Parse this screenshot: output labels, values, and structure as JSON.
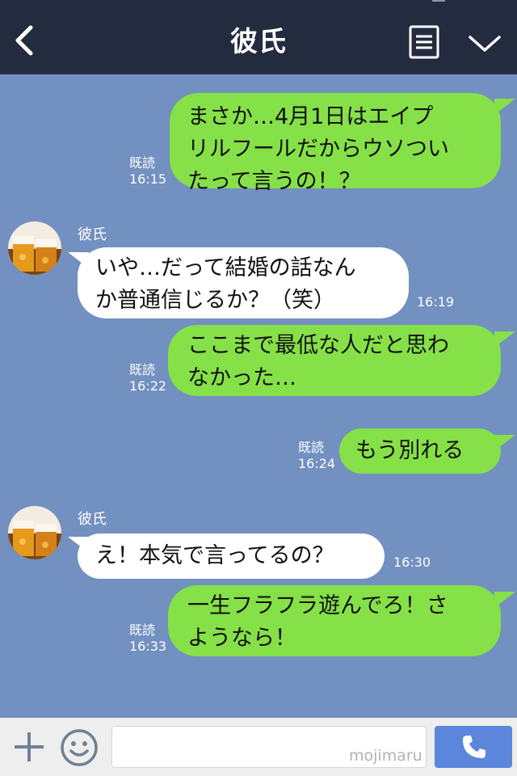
{
  "header": {
    "title": "彼氏",
    "back_icon": "chevron-left-icon",
    "menu_icon": "document-menu-icon",
    "expand_icon": "chevron-down-icon"
  },
  "messages": [
    {
      "from": "me",
      "text_lines": [
        "まさか…4月1日はエイプ",
        "リルフールだからウソつい",
        "たって言うの！？"
      ],
      "read": "既読",
      "time": "16:15"
    },
    {
      "from": "them",
      "sender": "彼氏",
      "text_lines": [
        "いや…だって結婚の話なん",
        "か普通信じるか？（笑）"
      ],
      "time": "16:19"
    },
    {
      "from": "me",
      "text_lines": [
        "ここまで最低な人だと思わ",
        "なかった…"
      ],
      "read": "既読",
      "time": "16:22"
    },
    {
      "from": "me",
      "text_lines": [
        "もう別れる"
      ],
      "read": "既読",
      "time": "16:24"
    },
    {
      "from": "them",
      "sender": "彼氏",
      "text_lines": [
        "え！本気で言ってるの？"
      ],
      "time": "16:30"
    },
    {
      "from": "me",
      "text_lines": [
        "一生フラフラ遊んでろ！さ",
        "ようなら！"
      ],
      "read": "既読",
      "time": "16:33"
    }
  ],
  "footer": {
    "plus_icon": "plus-icon",
    "emoji_icon": "smiley-icon",
    "input_value": "",
    "watermark": "mojimaru",
    "call_icon": "phone-icon"
  },
  "colors": {
    "header_bg": "#232b3e",
    "chat_bg": "#7290c0",
    "my_bubble": "#86e048",
    "their_bubble": "#ffffff",
    "call_button": "#5b86dc"
  }
}
